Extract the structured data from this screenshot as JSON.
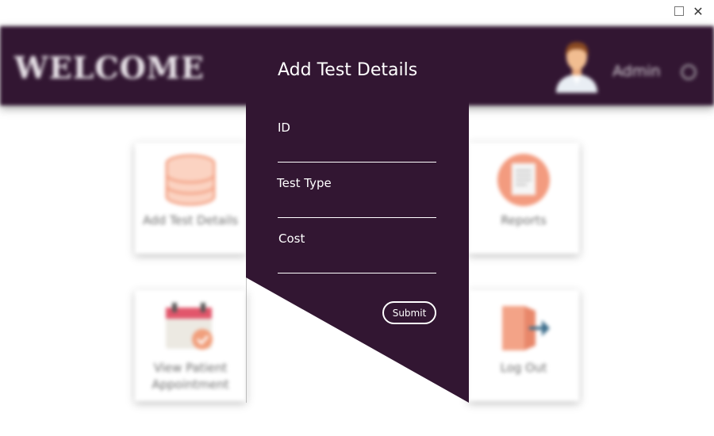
{
  "window": {
    "maximize_icon": "maximize-icon",
    "close_icon": "close-icon",
    "close_glyph": "✕"
  },
  "header": {
    "title": "WELCOME",
    "user_label": "Admin",
    "avatar_icon": "doctor-avatar",
    "settings_icon": "gear-icon",
    "bg_color": "#321632"
  },
  "dashboard": {
    "cards": [
      {
        "label": "Add Test Details",
        "icon": "database-icon"
      },
      {
        "label": "Reports",
        "icon": "report-icon"
      },
      {
        "label": "View Patient Appointment",
        "icon": "calendar-icon"
      },
      {
        "label": "Log Out",
        "icon": "logout-icon"
      }
    ]
  },
  "modal": {
    "title": "Add Test Details",
    "fields": [
      {
        "label": "ID",
        "value": ""
      },
      {
        "label": "Test Type",
        "value": ""
      },
      {
        "label": "Cost",
        "value": ""
      }
    ],
    "submit_label": "Submit",
    "bg_color": "#321632"
  }
}
